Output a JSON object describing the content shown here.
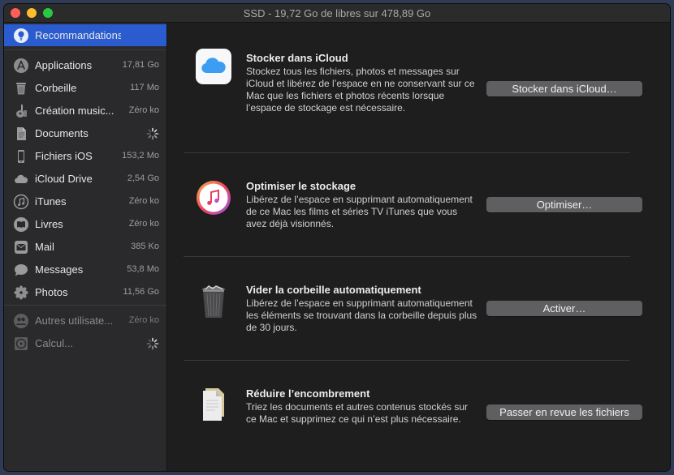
{
  "window": {
    "title": "SSD - 19,72 Go de libres sur 478,89 Go"
  },
  "sidebar": {
    "items": [
      {
        "label": "Recommandations",
        "size": "",
        "icon": "lightbulb-icon",
        "selected": true
      },
      {
        "label": "Applications",
        "size": "17,81 Go",
        "icon": "app-store-icon"
      },
      {
        "label": "Corbeille",
        "size": "117 Mo",
        "icon": "trash-icon"
      },
      {
        "label": "Création music...",
        "size": "Zéro ko",
        "icon": "guitar-icon"
      },
      {
        "label": "Documents",
        "size": "",
        "icon": "document-icon",
        "loading": true
      },
      {
        "label": "Fichiers iOS",
        "size": "153,2 Mo",
        "icon": "iphone-icon"
      },
      {
        "label": "iCloud Drive",
        "size": "2,54 Go",
        "icon": "cloud-icon"
      },
      {
        "label": "iTunes",
        "size": "Zéro ko",
        "icon": "music-note-icon"
      },
      {
        "label": "Livres",
        "size": "Zéro ko",
        "icon": "book-icon"
      },
      {
        "label": "Mail",
        "size": "385 Ko",
        "icon": "mail-icon"
      },
      {
        "label": "Messages",
        "size": "53,8 Mo",
        "icon": "message-icon"
      },
      {
        "label": "Photos",
        "size": "11,56 Go",
        "icon": "photos-flower-icon"
      },
      {
        "label": "Autres utilisate...",
        "size": "Zéro ko",
        "icon": "users-icon",
        "disabled": true
      },
      {
        "label": "Calcul...",
        "size": "",
        "icon": "disk-icon",
        "disabled": true,
        "loading": true
      }
    ]
  },
  "main": {
    "sections": [
      {
        "title": "Stocker dans iCloud",
        "description": "Stockez tous les fichiers, photos et messages sur iCloud et libérez de l’espace en ne conservant sur ce Mac que les fichiers et photos récents lorsque l’espace de stockage est nécessaire.",
        "button": "Stocker dans iCloud…",
        "icon": "icloud-icon"
      },
      {
        "title": "Optimiser le stockage",
        "description": "Libérez de l’espace en supprimant automatiquement de ce Mac les films et séries TV iTunes que vous avez déjà visionnés.",
        "button": "Optimiser…",
        "icon": "itunes-icon"
      },
      {
        "title": "Vider la corbeille automatiquement",
        "description": "Libérez de l’espace en supprimant automatiquement les éléments se trouvant dans la corbeille depuis plus de 30 jours.",
        "button": "Activer…",
        "icon": "full-trash-icon"
      },
      {
        "title": "Réduire l’encombrement",
        "description": "Triez les documents et autres contenus stockés sur ce Mac et supprimez ce qui n’est plus nécessaire.",
        "button": "Passer en revue les fichiers",
        "icon": "documents-stack-icon"
      }
    ]
  }
}
